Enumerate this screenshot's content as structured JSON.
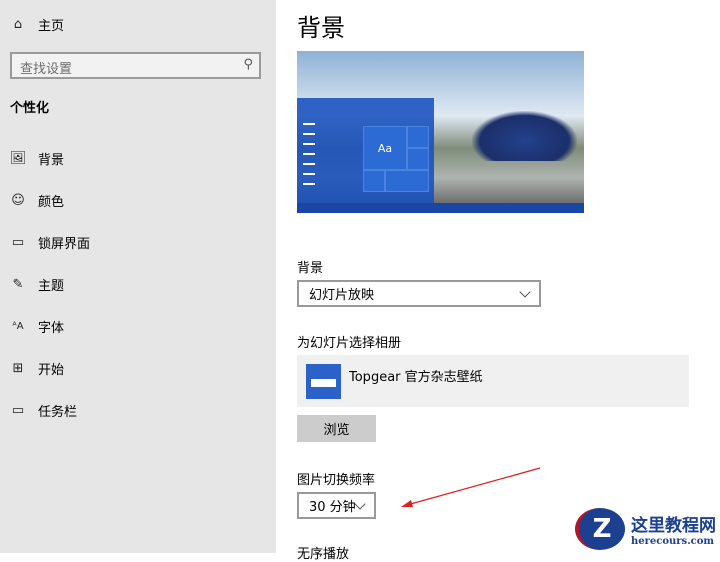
{
  "sidebar": {
    "home": "主页",
    "search_placeholder": "查找设置",
    "section": "个性化",
    "items": [
      {
        "label": "背景",
        "icon": "picture-icon"
      },
      {
        "label": "颜色",
        "icon": "palette-icon"
      },
      {
        "label": "锁屏界面",
        "icon": "lock-screen-icon"
      },
      {
        "label": "主题",
        "icon": "theme-icon"
      },
      {
        "label": "字体",
        "icon": "font-icon"
      },
      {
        "label": "开始",
        "icon": "start-icon"
      },
      {
        "label": "任务栏",
        "icon": "taskbar-icon"
      }
    ]
  },
  "main": {
    "title": "背景",
    "preview_tile": "Aa",
    "background_label": "背景",
    "background_value": "幻灯片放映",
    "album_label": "为幻灯片选择相册",
    "album_name": "Topgear 官方杂志壁纸",
    "browse": "浏览",
    "interval_label": "图片切换频率",
    "interval_value": "30 分钟",
    "shuffle_label": "无序播放"
  },
  "watermark": {
    "logo": "Z",
    "name": "这里教程网",
    "url": "herecours.com"
  },
  "colors": {
    "accent": "#2b62c9",
    "arrow": "#e02020"
  }
}
